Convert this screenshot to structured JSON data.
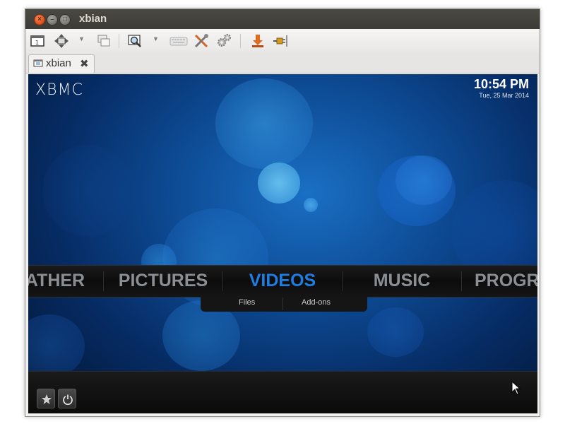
{
  "window": {
    "title": "xbian"
  },
  "toolbar": {
    "items": [
      {
        "icon": "screen-icon"
      },
      {
        "icon": "move-icon"
      },
      {
        "icon": "windows-icon"
      },
      {
        "icon": "zoom-icon"
      },
      {
        "icon": "keyboard-icon"
      },
      {
        "icon": "tools-icon"
      },
      {
        "icon": "settings-icon"
      },
      {
        "icon": "transfer-icon"
      },
      {
        "icon": "plug-icon"
      }
    ]
  },
  "tab": {
    "label": "xbian",
    "close_glyph": "✖"
  },
  "xbmc": {
    "logo": "XBMC",
    "clock": {
      "time": "10:54 PM",
      "date": "Tue, 25 Mar 2014"
    },
    "menu": [
      {
        "label": "ATHER",
        "active": false
      },
      {
        "label": "PICTURES",
        "active": false
      },
      {
        "label": "VIDEOS",
        "active": true
      },
      {
        "label": "MUSIC",
        "active": false
      },
      {
        "label": "PROGRA",
        "active": false
      }
    ],
    "submenu": [
      {
        "label": "Files"
      },
      {
        "label": "Add-ons"
      }
    ],
    "footer": [
      {
        "icon": "star-icon"
      },
      {
        "icon": "power-icon"
      }
    ]
  },
  "colors": {
    "accent": "#1e7de0",
    "menu_text": "#8b8f94",
    "title_bar": "#3c3b37"
  }
}
